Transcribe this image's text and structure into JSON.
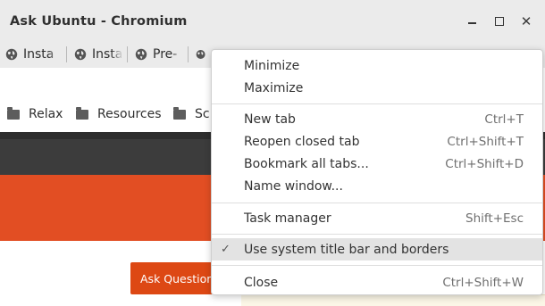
{
  "window": {
    "title": "Ask Ubuntu - Chromium",
    "minimize_icon": "minimize-icon",
    "maximize_icon": "maximize-icon",
    "close_icon": "close-icon"
  },
  "tabs": [
    {
      "label": "Insta",
      "icon": "globe-icon"
    },
    {
      "label": "Insta",
      "icon": "globe-icon"
    },
    {
      "label": "Pre-",
      "icon": "globe-icon"
    }
  ],
  "bookmarks": [
    {
      "label": "Relax",
      "icon": "folder-icon"
    },
    {
      "label": "Resources",
      "icon": "folder-icon"
    },
    {
      "label": "Sc",
      "icon": "folder-icon"
    }
  ],
  "page": {
    "ask_button": "Ask Question",
    "brand_color": "#e24e23"
  },
  "menu": {
    "items": [
      {
        "label": "Minimize",
        "shortcut": ""
      },
      {
        "label": "Maximize",
        "shortcut": ""
      },
      {
        "label": "New tab",
        "shortcut": "Ctrl+T"
      },
      {
        "label": "Reopen closed tab",
        "shortcut": "Ctrl+Shift+T"
      },
      {
        "label": "Bookmark all tabs...",
        "shortcut": "Ctrl+Shift+D"
      },
      {
        "label": "Name window...",
        "shortcut": ""
      },
      {
        "label": "Task manager",
        "shortcut": "Shift+Esc"
      },
      {
        "label": "Use system title bar and borders",
        "shortcut": "",
        "checked": true
      },
      {
        "label": "Close",
        "shortcut": "Ctrl+Shift+W"
      }
    ],
    "check_mark": "✓"
  }
}
